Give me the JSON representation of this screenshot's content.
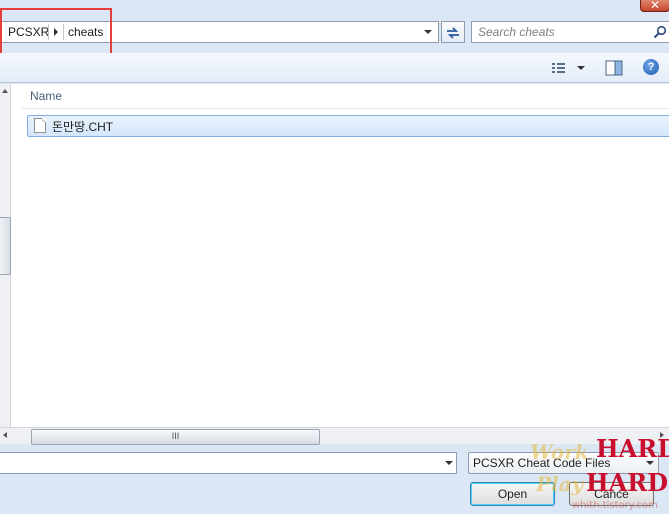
{
  "window": {
    "close_glyph": "✕"
  },
  "address_bar": {
    "crumbs": [
      "PCSXR",
      "cheats"
    ]
  },
  "refresh": {
    "glyph": "↹"
  },
  "search": {
    "placeholder": "Search cheats"
  },
  "toolbar": {
    "views_icon": "views-icon",
    "preview_icon": "preview-pane-icon",
    "help_glyph": "?"
  },
  "file_list": {
    "columns": [
      "Name"
    ],
    "files": [
      {
        "name": "돈만땅.CHT",
        "selected": true
      }
    ]
  },
  "scrollbar": {
    "grip": "III"
  },
  "bottom": {
    "file_name_value": "",
    "file_type": "PCSXR Cheat Code Files",
    "open_label": "Open",
    "cancel_label": "Cance"
  },
  "watermark": {
    "hard1": "HARD",
    "hard2": "HARD",
    "work": "Work",
    "play": "Play",
    "url": "whith.tistory.com"
  },
  "colors": {
    "highlight_box": "#e53e3e",
    "selection_border": "#84acdd",
    "watermark_red": "#c8102e"
  }
}
